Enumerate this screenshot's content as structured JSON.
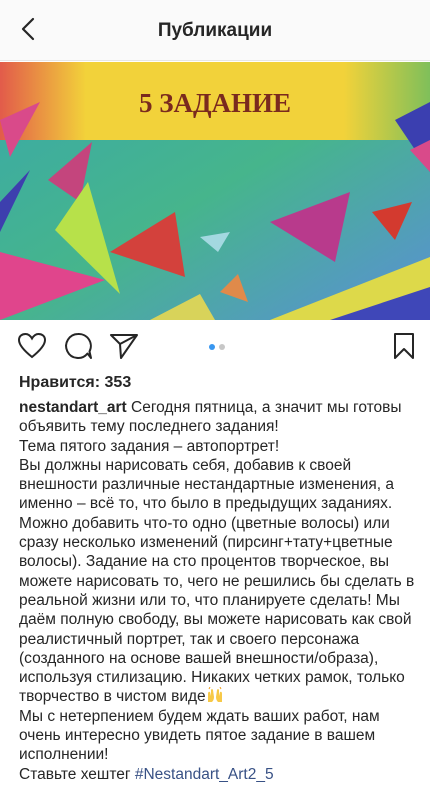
{
  "header": {
    "back_icon": "chevron-left-icon",
    "title": "Публикации"
  },
  "post_image": {
    "banner_text": "5 ЗАДАНИЕ",
    "colors": {
      "banner_yellow": "#f2d23a",
      "banner_text": "#7a2a1e",
      "bg_green": "#3fb4a0",
      "bg_blue": "#4f8fd8"
    }
  },
  "actions": {
    "like_icon": "heart-outline-icon",
    "comment_icon": "comment-bubble-icon",
    "share_icon": "paper-plane-icon",
    "save_icon": "bookmark-outline-icon",
    "carousel": {
      "active_index": 0,
      "count": 2,
      "active_color": "#3897f0",
      "inactive_color": "#c7c7c7"
    }
  },
  "likes_text": "Нравится: 353",
  "caption": {
    "username": "nestandart_art",
    "paragraphs": [
      "Сегодня пятница, а значит мы готовы объявить тему последнего задания!",
      "Тема пятого задания – автопортрет!",
      "Вы должны нарисовать себя, добавив к своей внешности различные нестандартные изменения, а именно – всё то, что было в предыдущих заданиях. Можно добавить что-то одно (цветные волосы) или сразу несколько изменений (пирсинг+тату+цветные волосы). Задание на сто процентов творческое, вы можете нарисовать то, чего не решились бы сделать в реальной жизни или то, что планируете сделать! Мы даём полную свободу, вы можете нарисовать как свой реалистичный портрет, так и своего персонажа (созданного на основе вашей внешности/образа), используя стилизацию. Никаких четких рамок, только творчество в чистом виде",
      "Мы с нетерпением будем ждать ваших работ, нам очень интересно увидеть пятое задание в вашем исполнении!",
      "Ставьте хештег"
    ],
    "hashtag": "#Nestandart_Art2_5",
    "emoji_icon": "raised-hands-emoji-icon"
  }
}
